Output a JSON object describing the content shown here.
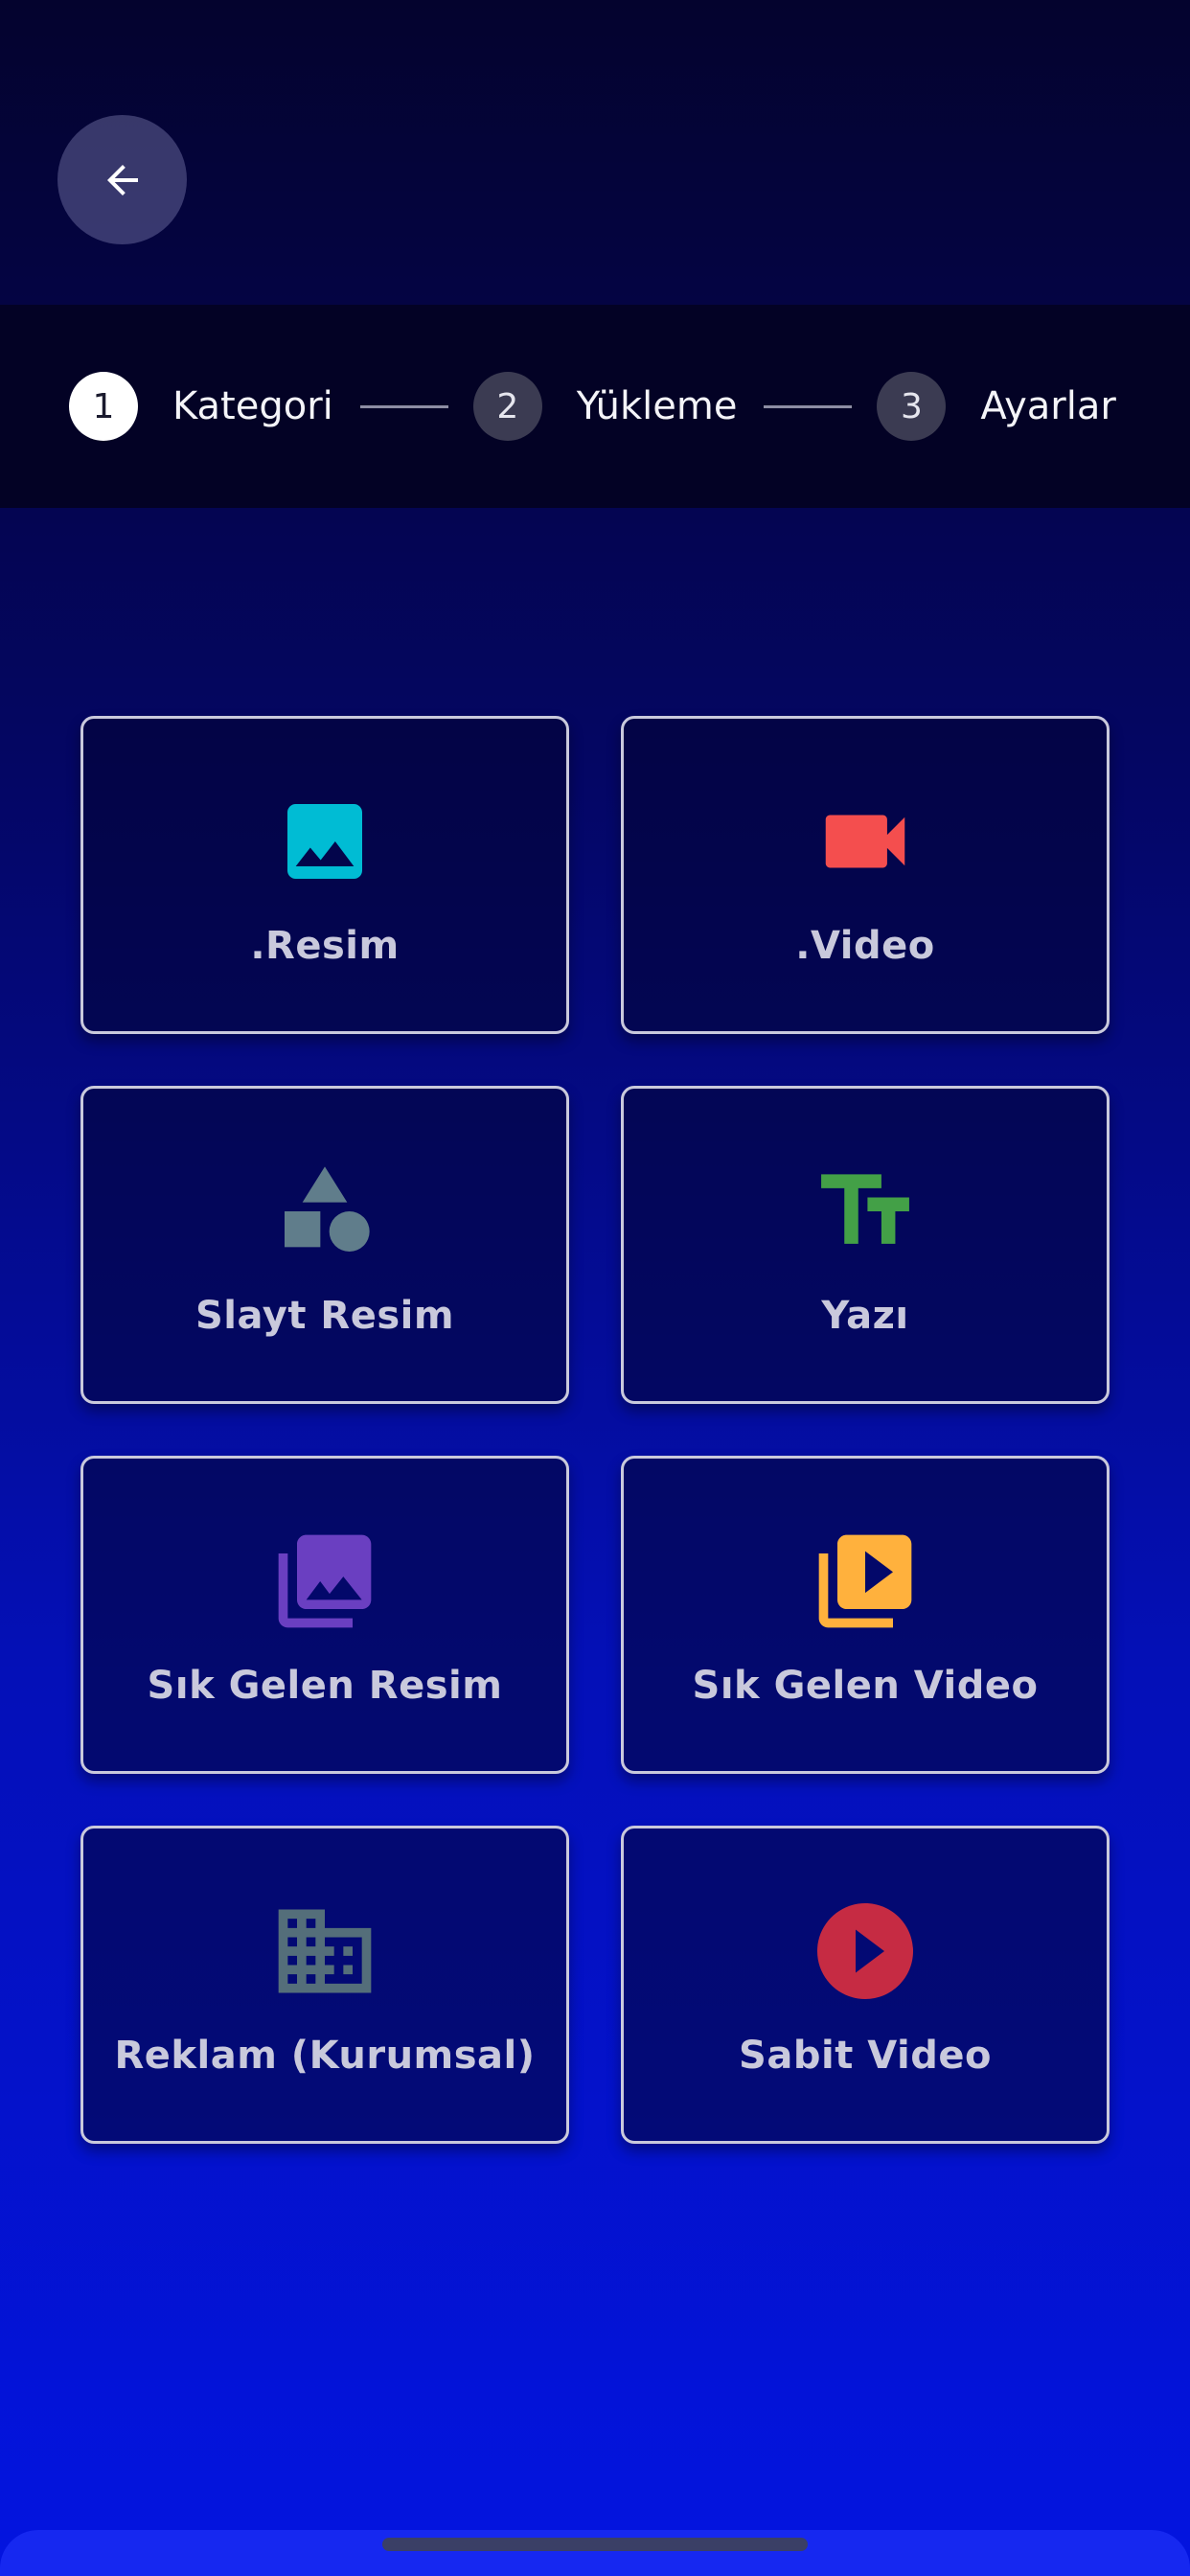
{
  "header": {
    "back_icon": "arrow-left-icon"
  },
  "stepper": {
    "steps": [
      {
        "number": "1",
        "label": "Kategori",
        "state": "active"
      },
      {
        "number": "2",
        "label": "Yükleme",
        "state": "inactive"
      },
      {
        "number": "3",
        "label": "Ayarlar",
        "state": "inactive"
      }
    ]
  },
  "categories": [
    {
      "label": ".Resim",
      "icon": "image-icon",
      "color": "#00bcd4"
    },
    {
      "label": ".Video",
      "icon": "videocam-icon",
      "color": "#f44e4e"
    },
    {
      "label": "Slayt Resim",
      "icon": "shapes-icon",
      "color": "#607d8b"
    },
    {
      "label": "Yazı",
      "icon": "text-fields-icon",
      "color": "#43a047"
    },
    {
      "label": "Sık Gelen Resim",
      "icon": "photo-library-icon",
      "color": "#6a3fc1"
    },
    {
      "label": "Sık Gelen Video",
      "icon": "video-library-icon",
      "color": "#ffb13d"
    },
    {
      "label": "Reklam (Kurumsal)",
      "icon": "business-icon",
      "color": "#546e7a"
    },
    {
      "label": "Sabit Video",
      "icon": "play-circle-icon",
      "color": "#c62b43"
    }
  ]
}
